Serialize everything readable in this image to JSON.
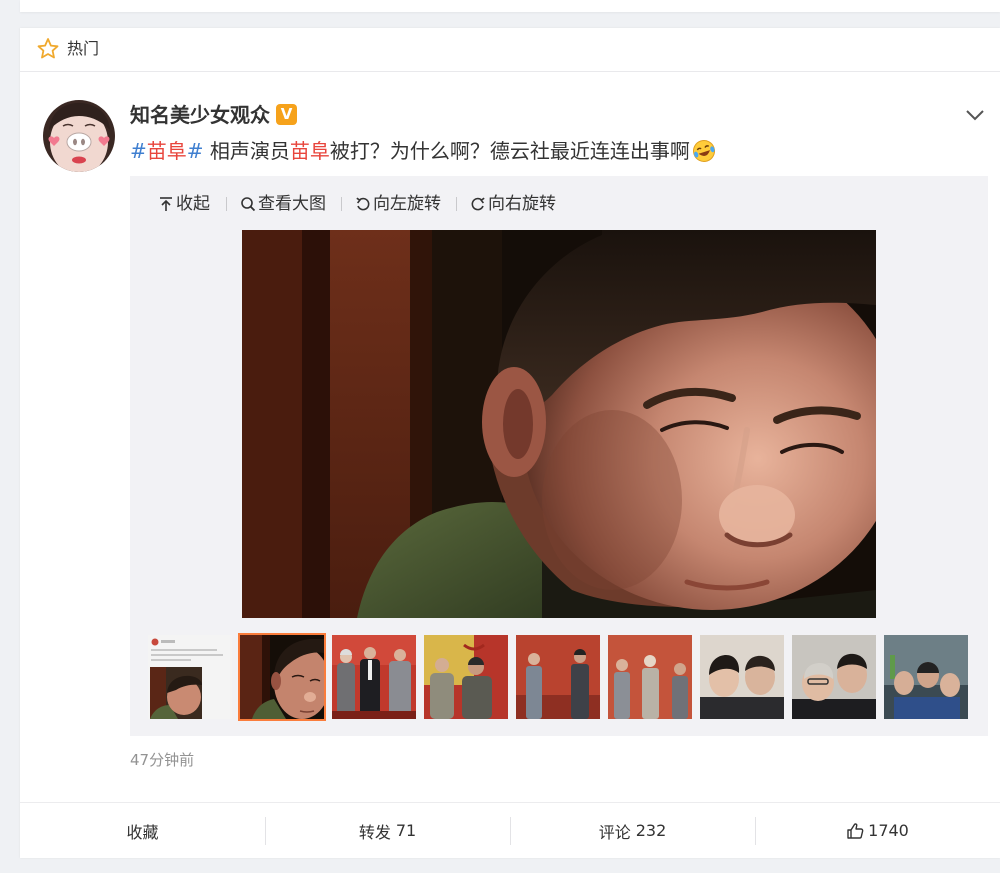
{
  "section_header": {
    "icon": "star-icon",
    "label": "热门"
  },
  "post": {
    "author": {
      "name": "知名美少女观众",
      "badge": "V",
      "menu_icon": "chevron-down-icon"
    },
    "text_parts": [
      {
        "text": "#"
      },
      {
        "text": "苗阜"
      },
      {
        "text": "#"
      },
      {
        "text": " 相声演员"
      },
      {
        "text": "苗阜"
      },
      {
        "text": "被打？为什么啊？德云社最近连连出事啊"
      }
    ],
    "emoji": "laugh-cry-emoji-icon",
    "media": {
      "toolbar": [
        {
          "icon": "collapse-icon",
          "label": "收起"
        },
        {
          "icon": "search-icon",
          "label": "查看大图"
        },
        {
          "icon": "rotate-left-icon",
          "label": "向左旋转"
        },
        {
          "icon": "rotate-right-icon",
          "label": "向右旋转"
        }
      ],
      "selected_thumbnail": 2
    },
    "timestamp": "47分钟前",
    "actions": {
      "favorite": {
        "label": "收藏"
      },
      "repost": {
        "label": "转发",
        "count": "71"
      },
      "comment": {
        "label": "评论",
        "count": "232"
      },
      "like": {
        "icon": "thumbs-up-icon",
        "count": "1740"
      }
    }
  },
  "colors": {
    "accent": "#fa7d3c",
    "topic": "#3f7fd0",
    "keyword": "#e8453c",
    "badge": "#f6a21b"
  }
}
